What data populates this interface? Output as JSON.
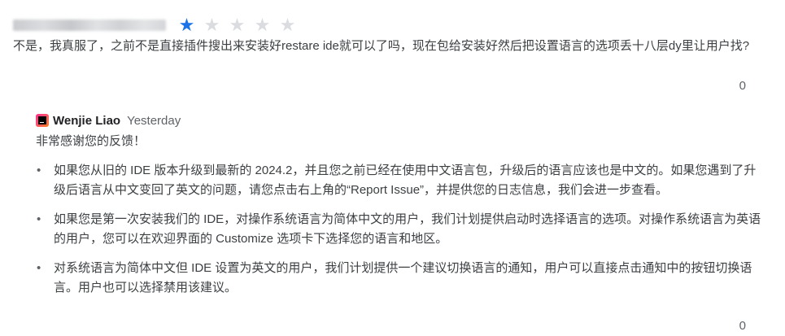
{
  "review": {
    "rating": 1,
    "max_rating": 5,
    "text": "不是，我真服了，之前不是直接插件搜出来安装好restare ide就可以了吗，现在包给安装好然后把设置语言的选项丢十八层dy里让用户找?",
    "helpful_count": "0"
  },
  "reply": {
    "author": "Wenjie Liao",
    "date": "Yesterday",
    "intro": "非常感谢您的反馈！",
    "bullets": [
      "如果您从旧的 IDE 版本升级到最新的 2024.2，并且您之前已经在使用中文语言包，升级后的语言应该也是中文的。如果您遇到了升级后语言从中文变回了英文的问题，请您点击右上角的“Report Issue”，并提供您的日志信息，我们会进一步查看。",
      "如果您是第一次安装我们的 IDE，对操作系统语言为简体中文的用户，我们计划提供启动时选择语言的选项。对操作系统语言为英语的用户，您可以在欢迎界面的 Customize 选项卡下选择您的语言和地区。",
      "对系统语言为简体中文但 IDE 设置为英文的用户，我们计划提供一个建议切换语言的通知，用户可以直接点击通知中的按钮切换语言。用户也可以选择禁用该建议。"
    ],
    "helpful_count": "0"
  },
  "colors": {
    "star_filled": "#1a73e8",
    "star_empty": "#dadce0"
  },
  "icons": {
    "avatar": "jetbrains-logo-icon"
  }
}
